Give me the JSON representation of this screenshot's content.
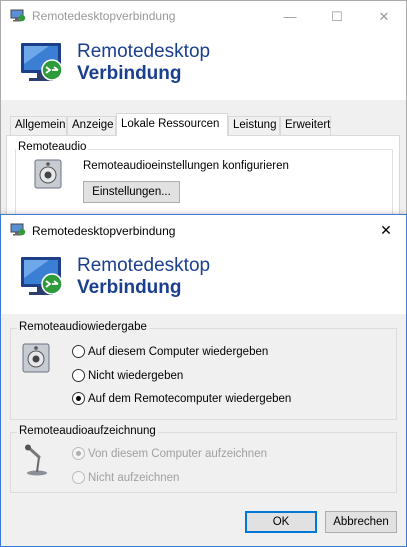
{
  "back_window": {
    "title": "Remotedesktopverbindung",
    "window_controls": {
      "minimize": "—",
      "maximize": "☐",
      "close": "✕"
    },
    "banner": {
      "line1": "Remotedesktop",
      "line2": "Verbindung"
    },
    "tabs": [
      {
        "label": "Allgemein"
      },
      {
        "label": "Anzeige"
      },
      {
        "label": "Lokale Ressourcen",
        "active": true
      },
      {
        "label": "Leistung"
      },
      {
        "label": "Erweitert"
      }
    ],
    "remote_audio": {
      "group_title": "Remoteaudio",
      "description": "Remoteaudioeinstellungen konfigurieren",
      "settings_button": "Einstellungen..."
    }
  },
  "dialog": {
    "title": "Remotedesktopverbindung",
    "close_glyph": "✕",
    "banner": {
      "line1": "Remotedesktop",
      "line2": "Verbindung"
    },
    "playback": {
      "group_title": "Remoteaudiowiedergabe",
      "options": [
        {
          "label": "Auf diesem Computer wiedergeben",
          "checked": false
        },
        {
          "label": "Nicht wiedergeben",
          "checked": false
        },
        {
          "label": "Auf dem Remotecomputer wiedergeben",
          "checked": true
        }
      ]
    },
    "recording": {
      "group_title": "Remoteaudioaufzeichnung",
      "options": [
        {
          "label": "Von diesem Computer aufzeichnen",
          "checked": true,
          "disabled": true
        },
        {
          "label": "Nicht aufzeichnen",
          "checked": false,
          "disabled": true
        }
      ]
    },
    "ok_button": "OK",
    "cancel_button": "Abbrechen"
  },
  "colors": {
    "accent": "#0078d7",
    "banner_text": "#1b3f8f",
    "dialog_bg": "#f0f0f0"
  }
}
